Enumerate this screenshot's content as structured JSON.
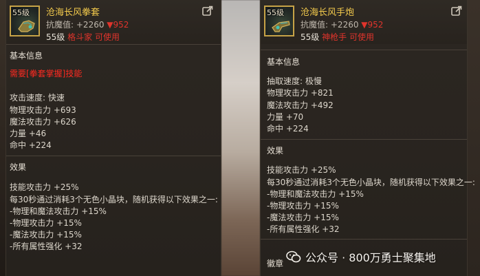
{
  "left_panel": {
    "icon_level": "55级",
    "name": "沧海长风拳套",
    "resist_label": "抗魔值:",
    "resist_up": "+2260",
    "resist_down": "▼952",
    "req_level": "55级",
    "req_class": "格斗家",
    "req_use": "可使用",
    "basic_title": "基本信息",
    "requirement": "需要[拳套掌握]技能",
    "stats": [
      "攻击速度: 快速",
      "物理攻击力 +693",
      "魔法攻击力 +626",
      "力量 +46",
      "命中 +224"
    ],
    "effect_title": "效果",
    "effects": [
      "技能攻击力 +25%",
      "每30秒通过消耗3个无色小晶块，随机获得以下效果之一:",
      "-物理和魔法攻击力 +15%",
      "-物理攻击力 +15%",
      "-魔法攻击力 +15%",
      "-所有属性强化 +32"
    ]
  },
  "right_panel": {
    "icon_level": "55级",
    "name": "沧海长风手炮",
    "resist_label": "抗魔值:",
    "resist_up": "+2260",
    "resist_down": "▼952",
    "req_level": "55级",
    "req_class": "神枪手",
    "req_use": "可使用",
    "basic_title": "基本信息",
    "stats": [
      "抽取速度: 极慢",
      "物理攻击力 +821",
      "魔法攻击力 +492",
      "力量 +70",
      "命中 +224"
    ],
    "effect_title": "效果",
    "effects": [
      "技能攻击力 +25%",
      "每30秒通过消耗3个无色小晶块，随机获得以下效果之一:",
      "-物理和魔法攻击力 +15%",
      "-物理攻击力 +15%",
      "-魔法攻击力 +15%",
      "-所有属性强化 +32"
    ],
    "emblem_title": "徽章"
  },
  "watermark": {
    "text": "公众号 · 800万勇士聚集地",
    "icon": "wechat-logo-icon"
  },
  "colors": {
    "item_name": "#f2c94c",
    "negative": "#e0342c",
    "requirement_red": "#ff2a20"
  }
}
